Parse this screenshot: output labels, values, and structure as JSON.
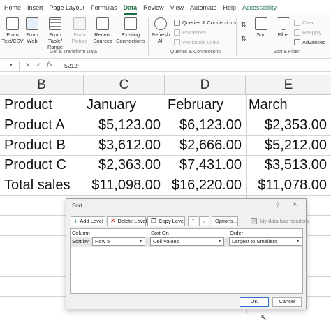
{
  "menu": {
    "tabs": [
      "Home",
      "Insert",
      "Page Layout",
      "Formulas",
      "Data",
      "Review",
      "View",
      "Automate",
      "Help",
      "Accessibility"
    ],
    "active": "Data"
  },
  "ribbon": {
    "get_transform": {
      "from_text_csv": "From Text/CSV",
      "from_web": "From Web",
      "from_table_range": "From Table/ Range",
      "from_picture": "From Picture",
      "recent_sources": "Recent Sources",
      "existing_connections": "Existing Connections",
      "label": "Get & Transform Data"
    },
    "queries": {
      "refresh_all": "Refresh All",
      "queries_connections": "Queries & Connections",
      "properties": "Properties",
      "workbook_links": "Workbook Links",
      "label": "Queries & Connections"
    },
    "sort_filter": {
      "sort": "Sort",
      "filter": "Filter",
      "clear": "Clear",
      "reapply": "Reapply",
      "advanced": "Advanced",
      "label": "Sort & Filter"
    }
  },
  "formula_bar": {
    "name_box": "",
    "value": "5212"
  },
  "sheet": {
    "columns": [
      "B",
      "C",
      "D",
      "E"
    ],
    "rows": [
      [
        "Product",
        "January",
        "February",
        "March"
      ],
      [
        "Product A",
        "$5,123.00",
        "$6,123.00",
        "$2,353.00"
      ],
      [
        "Product B",
        "$3,612.00",
        "$2,666.00",
        "$5,212.00"
      ],
      [
        "Product C",
        "$2,363.00",
        "$7,431.00",
        "$3,513.00"
      ],
      [
        "Total sales",
        "$11,098.00",
        "$16,220.00",
        "$11,078.00"
      ]
    ]
  },
  "sort_dialog": {
    "title": "Sort",
    "help": "?",
    "close": "×",
    "add_level": "Add Level",
    "delete_level": "Delete Level",
    "copy_level": "Copy Level",
    "options": "Options...",
    "has_headers": "My data has headers",
    "headers": {
      "column": "Column",
      "sort_on": "Sort On",
      "order": "Order"
    },
    "row": {
      "label": "Sort by",
      "column": "Row 5",
      "sort_on": "Cell Values",
      "order": "Largest to Smallest"
    },
    "ok": "OK",
    "cancel": "Cancel"
  },
  "colors": {
    "accent": "#1e7145",
    "focus": "#2f6fcf"
  }
}
